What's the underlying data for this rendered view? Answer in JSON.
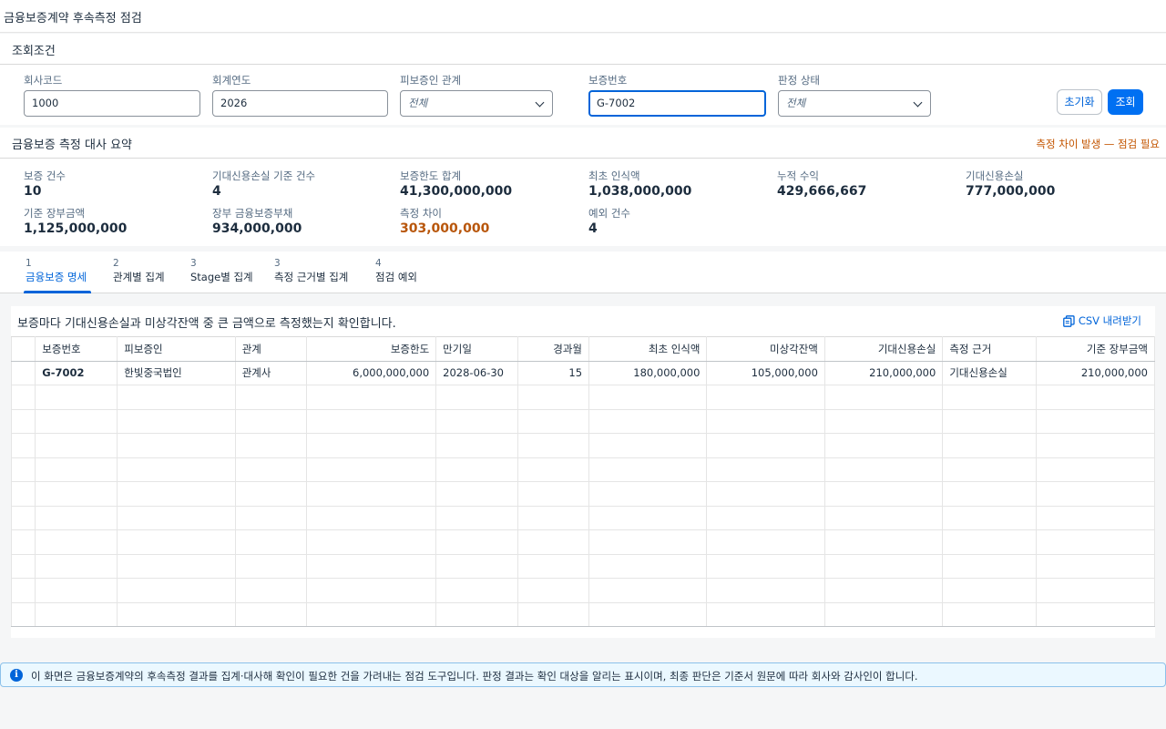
{
  "page": {
    "title": "금융보증계약 후속측정 점검"
  },
  "filters": {
    "section_title": "조회조건",
    "company_code": {
      "label": "회사코드",
      "value": "1000"
    },
    "fiscal_year": {
      "label": "회계연도",
      "value": "2026"
    },
    "relationship": {
      "label": "피보증인 관계",
      "value": "전체"
    },
    "guarantee_no": {
      "label": "보증번호",
      "value": "G-7002"
    },
    "judgment_status": {
      "label": "판정 상태",
      "value": "전체"
    },
    "reset_label": "초기화",
    "search_label": "조회"
  },
  "summary": {
    "title": "금융보증 측정 대사 요약",
    "warning": "측정 차이 발생 — 점검 필요",
    "kpis": [
      {
        "label": "보증 건수",
        "value": "10"
      },
      {
        "label": "기대신용손실 기준 건수",
        "value": "4"
      },
      {
        "label": "보증한도 합계",
        "value": "41,300,000,000"
      },
      {
        "label": "최초 인식액",
        "value": "1,038,000,000"
      },
      {
        "label": "누적 수익",
        "value": "429,666,667"
      },
      {
        "label": "기대신용손실",
        "value": "777,000,000"
      },
      {
        "label": "기준 장부금액",
        "value": "1,125,000,000"
      },
      {
        "label": "장부 금융보증부채",
        "value": "934,000,000"
      },
      {
        "label": "측정 차이",
        "value": "303,000,000"
      },
      {
        "label": "예외 건수",
        "value": "4"
      }
    ]
  },
  "tabs": [
    {
      "count": "1",
      "label": "금융보증 명세"
    },
    {
      "count": "2",
      "label": "관계별 집계"
    },
    {
      "count": "3",
      "label": "Stage별 집계"
    },
    {
      "count": "3",
      "label": "측정 근거별 집계"
    },
    {
      "count": "4",
      "label": "점검 예외"
    }
  ],
  "table": {
    "description": "보증마다 기대신용손실과 미상각잔액 중 큰 금액으로 측정했는지 확인합니다.",
    "csv_label": "CSV 내려받기",
    "columns": [
      "",
      "보증번호",
      "피보증인",
      "관계",
      "보증한도",
      "만기일",
      "경과월",
      "최초 인식액",
      "미상각잔액",
      "기대신용손실",
      "측정 근거",
      "기준 장부금액"
    ],
    "rows": [
      [
        "",
        "G-7002",
        "한빛중국법인",
        "관계사",
        "6,000,000,000",
        "2028-06-30",
        "15",
        "180,000,000",
        "105,000,000",
        "210,000,000",
        "기대신용손실",
        "210,000,000"
      ]
    ]
  },
  "info": {
    "icon": "info-icon",
    "text": "이 화면은 금융보증계약의 후속측정 결과를 집계·대사해 확인이 필요한 건을 가려내는 점검 도구입니다. 판정 결과는 확인 대상을 알리는 표시이며, 최종 판단은 기준서 원문에 따라 회사와 감사인이 합니다."
  },
  "colors": {
    "accent": "#0064d9",
    "primary_button": "#0070f2",
    "warning": "#c35500"
  }
}
